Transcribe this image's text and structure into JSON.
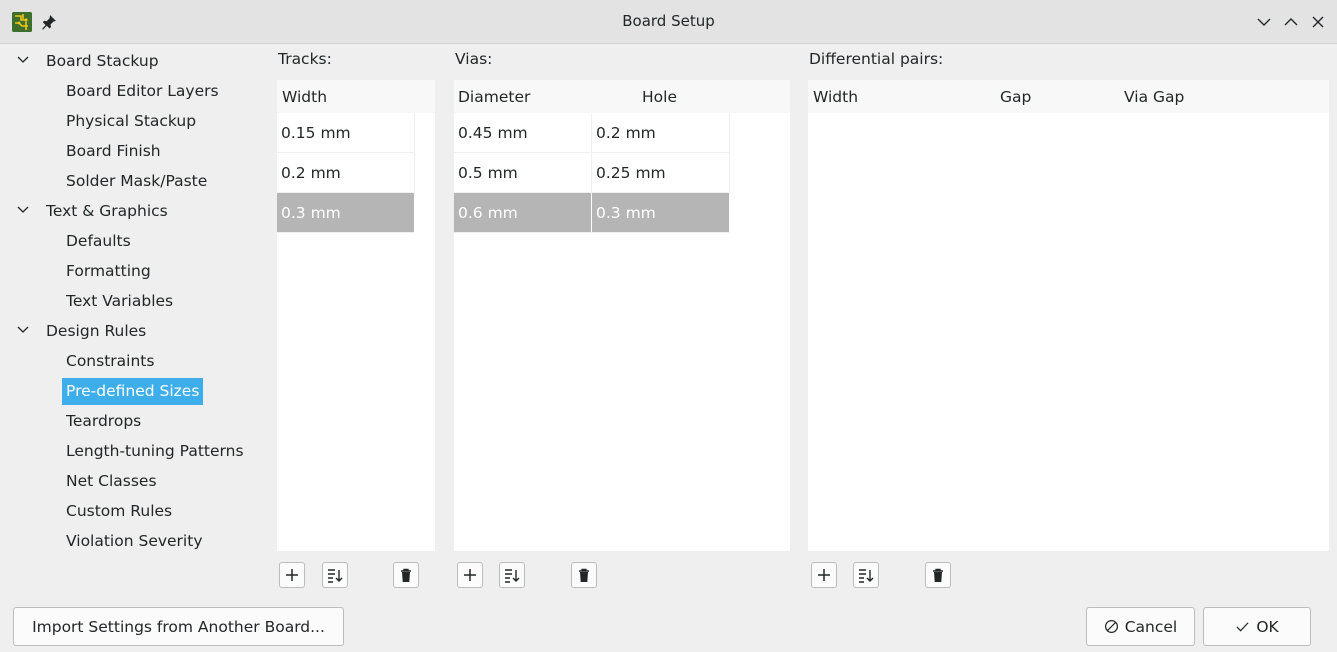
{
  "window": {
    "title": "Board Setup"
  },
  "tree": {
    "groups": [
      {
        "label": "Board Stackup",
        "children": [
          "Board Editor Layers",
          "Physical Stackup",
          "Board Finish",
          "Solder Mask/Paste"
        ]
      },
      {
        "label": "Text & Graphics",
        "children": [
          "Defaults",
          "Formatting",
          "Text Variables"
        ]
      },
      {
        "label": "Design Rules",
        "children": [
          "Constraints",
          "Pre-defined Sizes",
          "Teardrops",
          "Length-tuning Patterns",
          "Net Classes",
          "Custom Rules",
          "Violation Severity"
        ]
      }
    ],
    "selected": "Pre-defined Sizes"
  },
  "tracks": {
    "label": "Tracks:",
    "columns": [
      "Width"
    ],
    "rows": [
      [
        "0.15 mm"
      ],
      [
        "0.2 mm"
      ],
      [
        "0.3 mm"
      ]
    ],
    "selected_row": 2
  },
  "vias": {
    "label": "Vias:",
    "columns": [
      "Diameter",
      "Hole"
    ],
    "rows": [
      [
        "0.45 mm",
        "0.2 mm"
      ],
      [
        "0.5 mm",
        "0.25 mm"
      ],
      [
        "0.6 mm",
        "0.3 mm"
      ]
    ],
    "selected_row": 2
  },
  "diff_pairs": {
    "label": "Differential pairs:",
    "columns": [
      "Width",
      "Gap",
      "Via Gap"
    ],
    "rows": []
  },
  "footer": {
    "import_label": "Import Settings from Another Board...",
    "cancel_label": "Cancel",
    "ok_label": "OK"
  },
  "colors": {
    "selection_accent": "#3daee9",
    "row_selection": "#b5b5b5"
  },
  "icons": {
    "app": "kicad-pcb-icon",
    "pin": "pin-icon",
    "minimize": "chevron-down-icon",
    "maximize": "chevron-up-icon",
    "close": "close-icon",
    "add": "plus-icon",
    "sort": "sort-icon",
    "delete": "trash-icon",
    "cancel": "cancel-circle-icon",
    "ok": "checkmark-icon"
  }
}
